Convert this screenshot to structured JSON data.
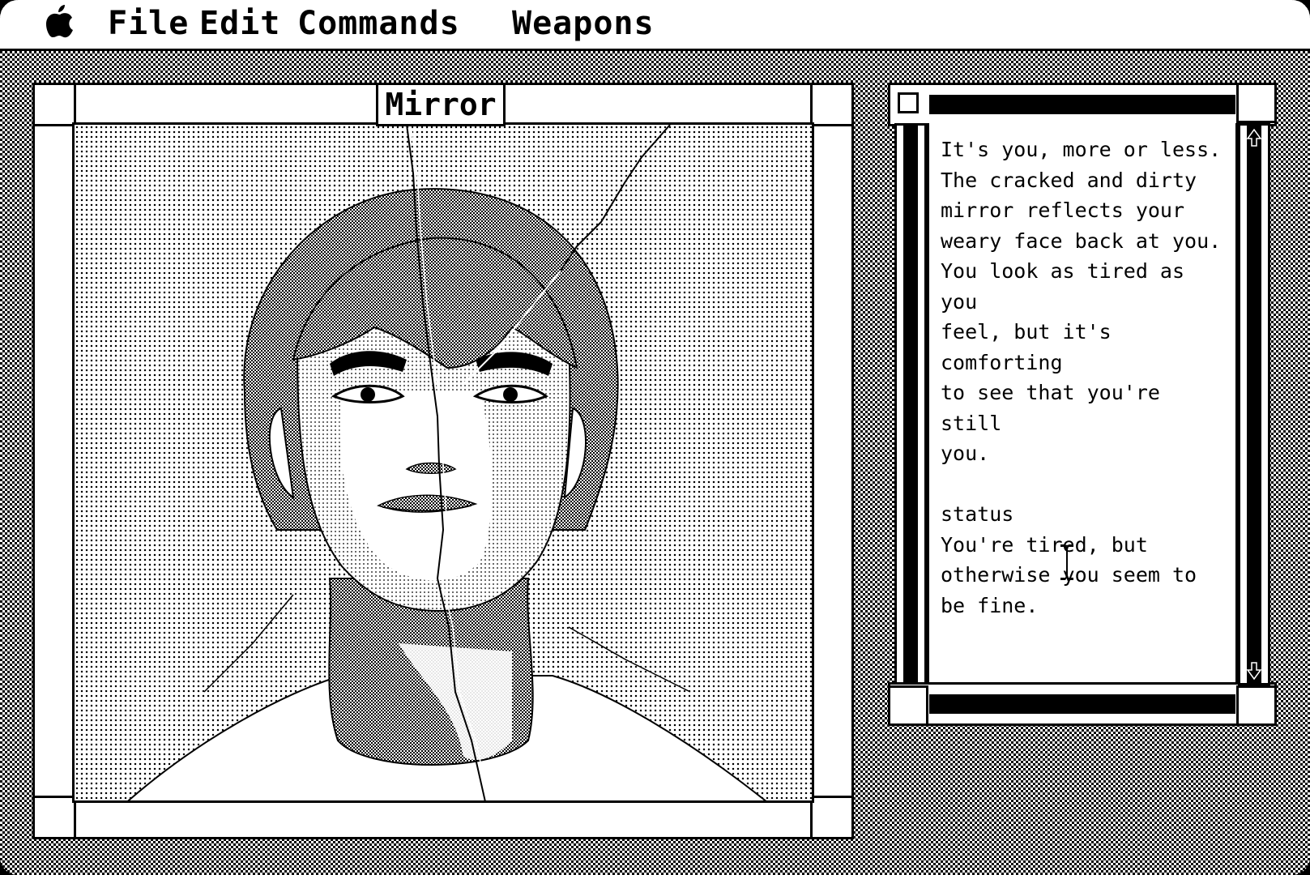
{
  "menubar": {
    "apple_icon": "apple-icon",
    "items": [
      "File",
      "Edit",
      "Commands",
      "Weapons"
    ]
  },
  "picture_window": {
    "title": "Mirror",
    "image": "cracked-mirror-portrait"
  },
  "text_window": {
    "description": "It's you, more or less.\nThe cracked and dirty\nmirror reflects your\nweary face back at you.\nYou look as tired as you\nfeel, but it's comforting\nto see that you're still\nyou.\n\nstatus\nYou're tired, but\notherwise you seem to\nbe fine.",
    "close_icon": "close-box-icon",
    "scroll_up_icon": "scroll-up-arrow-icon",
    "scroll_down_icon": "scroll-down-arrow-icon",
    "cursor_icon": "i-beam-cursor-icon"
  },
  "colors": {
    "foreground": "#000000",
    "background": "#ffffff"
  }
}
